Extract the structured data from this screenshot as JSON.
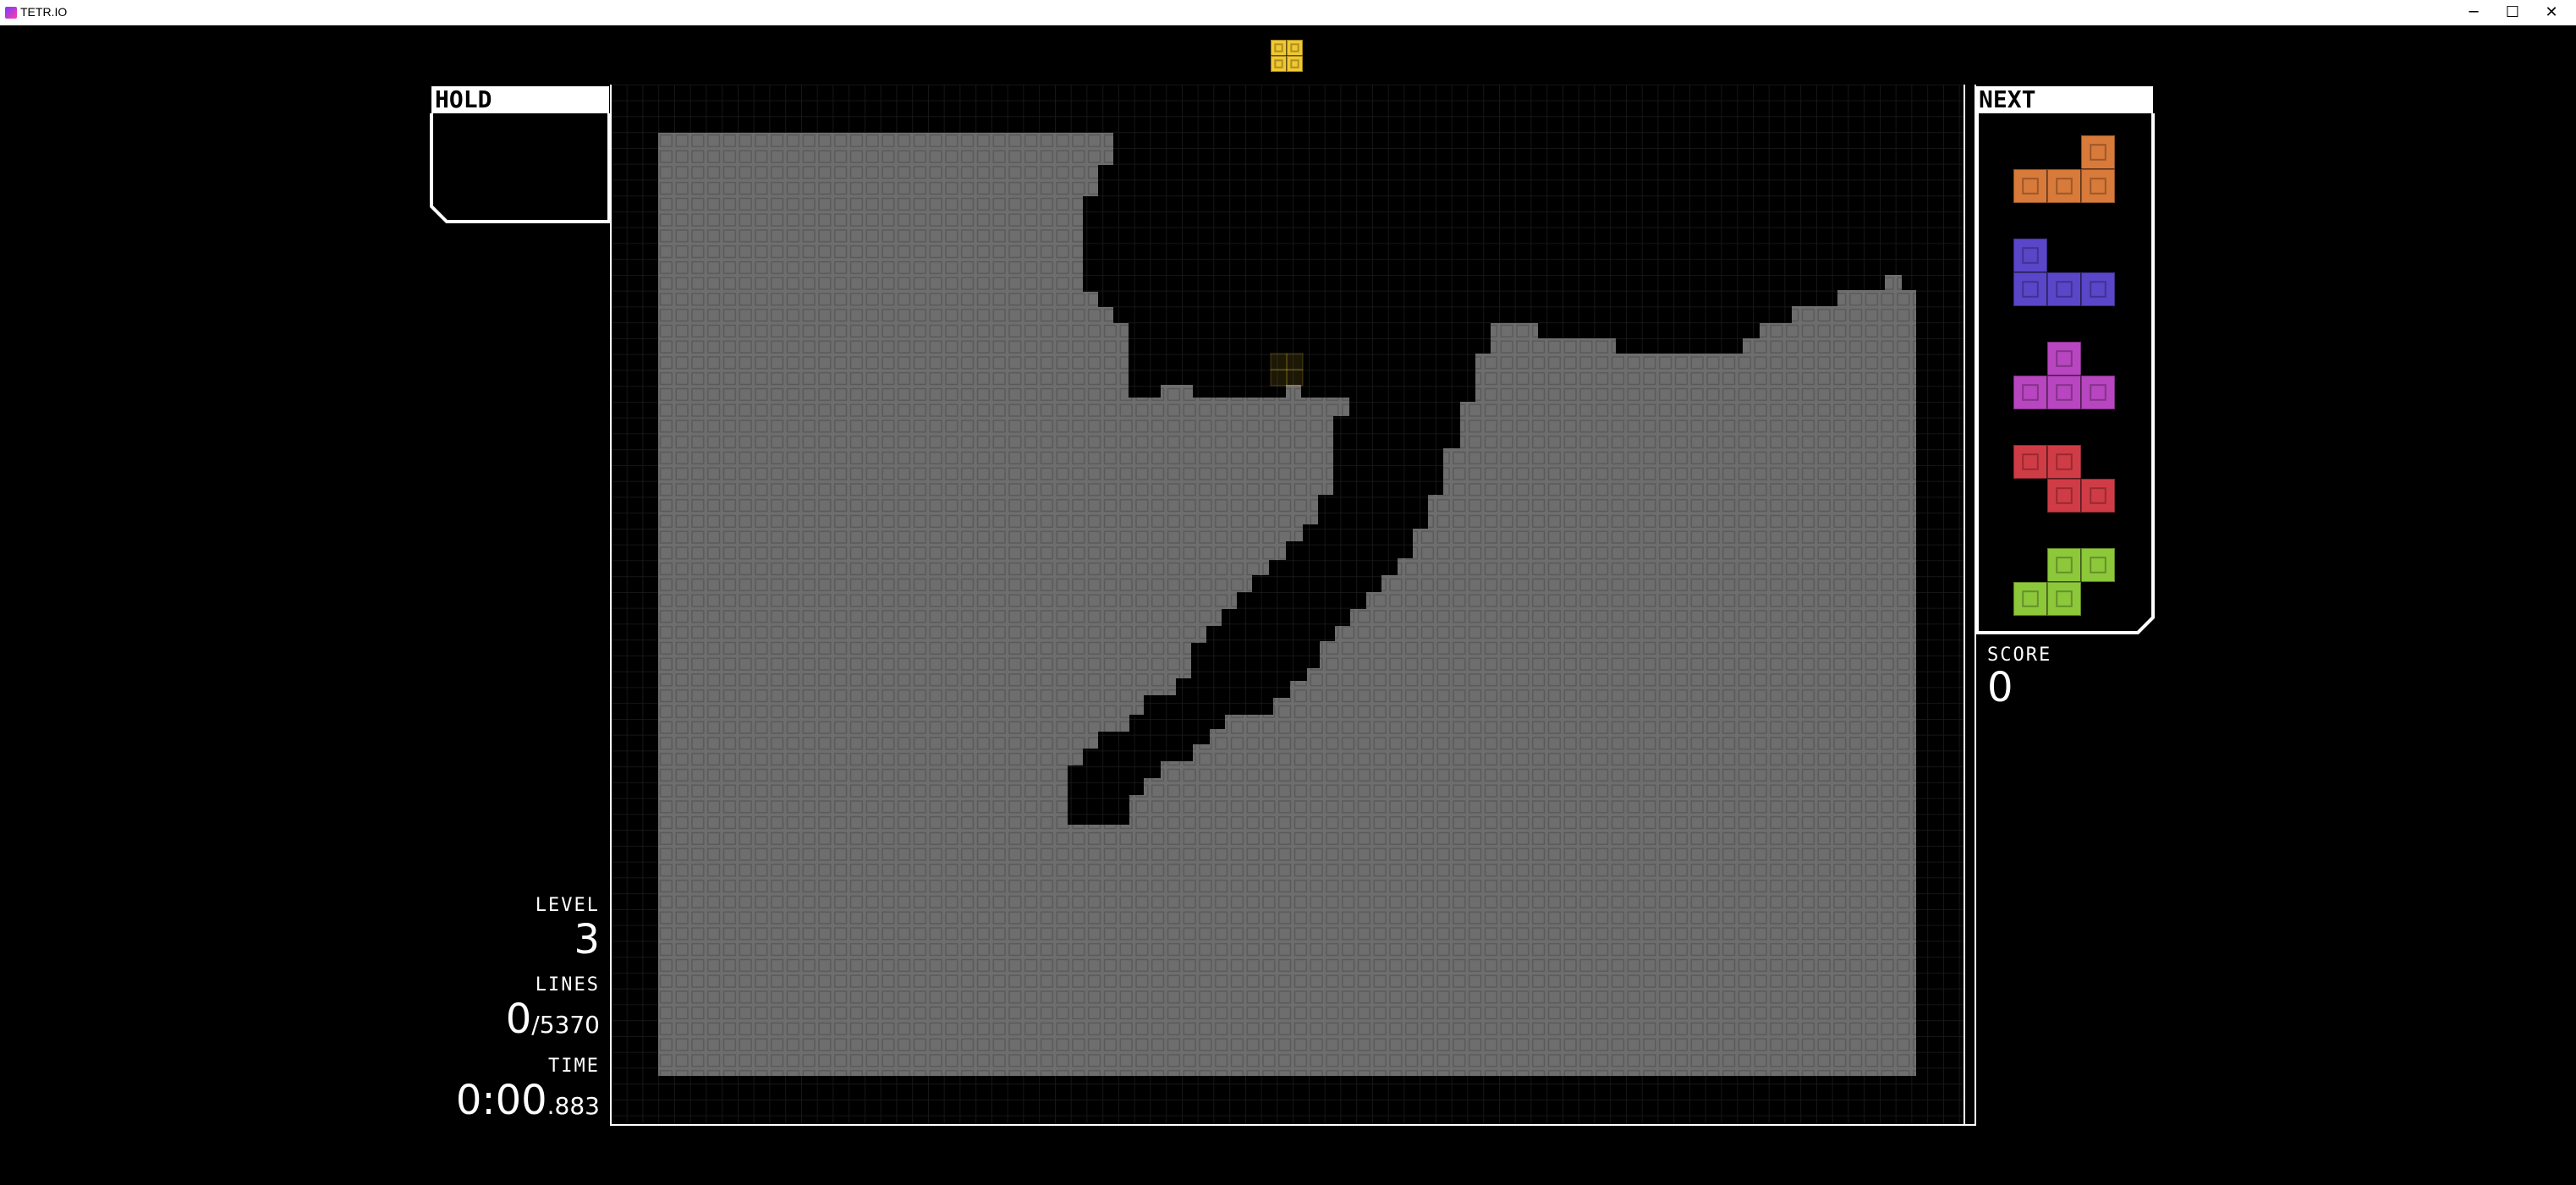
{
  "window": {
    "title": "TETR.IO",
    "minimize_glyph": "─",
    "maximize_glyph": "☐",
    "close_glyph": "✕"
  },
  "hold": {
    "label": "HOLD"
  },
  "next": {
    "label": "NEXT",
    "queue": [
      {
        "piece": "L",
        "color": "#d87a3a"
      },
      {
        "piece": "J",
        "color": "#5a46c8"
      },
      {
        "piece": "T",
        "color": "#b846c0"
      },
      {
        "piece": "Z",
        "color": "#d03c46"
      },
      {
        "piece": "S",
        "color": "#8cc83a"
      }
    ]
  },
  "score": {
    "label": "SCORE",
    "value": "0"
  },
  "stats": {
    "level_label": "LEVEL",
    "level_value": "3",
    "lines_label": "LINES",
    "lines_value": "0",
    "lines_target": "/5370",
    "time_label": "TIME",
    "time_main": "0:00",
    "time_ms": ".883"
  },
  "colors": {
    "garbage": "#6e6e6e",
    "falling_piece": "#f0c830",
    "board_border": "#ffffff",
    "grid_line": "#1c1c1c"
  },
  "falling_piece": {
    "type": "O"
  }
}
